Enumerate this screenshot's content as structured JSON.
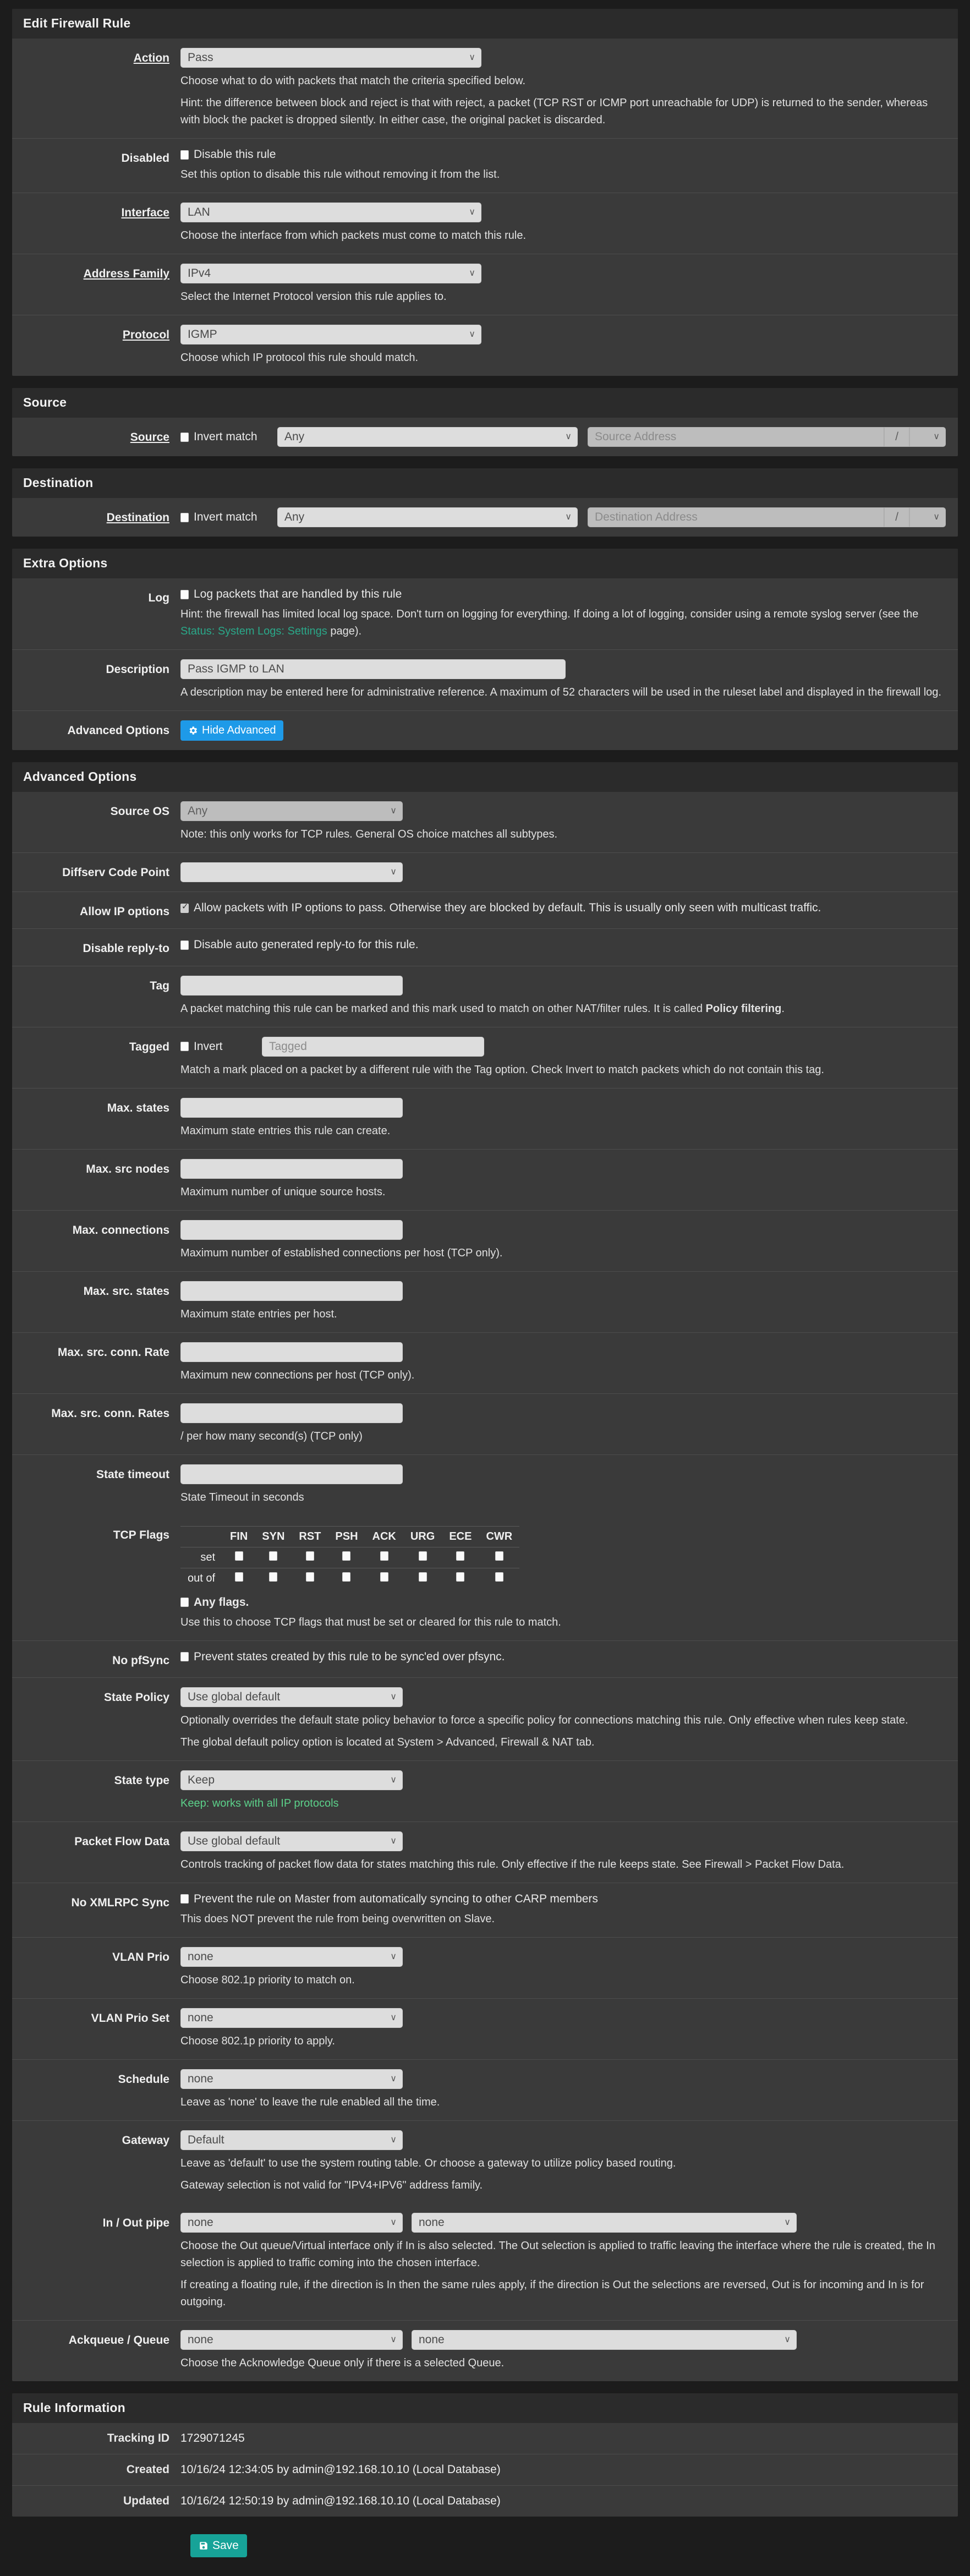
{
  "sections": {
    "rule": {
      "title": "Edit Firewall Rule",
      "action": {
        "label": "Action",
        "value": "Pass",
        "help1": "Choose what to do with packets that match the criteria specified below.",
        "help2": "Hint: the difference between block and reject is that with reject, a packet (TCP RST or ICMP port unreachable for UDP) is returned to the sender, whereas with block the packet is dropped silently. In either case, the original packet is discarded."
      },
      "disabled": {
        "label": "Disabled",
        "checkbox_label": "Disable this rule",
        "checked": false,
        "help": "Set this option to disable this rule without removing it from the list."
      },
      "interface": {
        "label": "Interface",
        "value": "LAN",
        "help": "Choose the interface from which packets must come to match this rule."
      },
      "address_family": {
        "label": "Address Family",
        "value": "IPv4",
        "help": "Select the Internet Protocol version this rule applies to."
      },
      "protocol": {
        "label": "Protocol",
        "value": "IGMP",
        "help": "Choose which IP protocol this rule should match."
      }
    },
    "source": {
      "title": "Source",
      "label": "Source",
      "invert_label": "Invert match",
      "invert_checked": false,
      "type": "Any",
      "address_placeholder": "Source Address",
      "slash": "/",
      "mask": ""
    },
    "destination": {
      "title": "Destination",
      "label": "Destination",
      "invert_label": "Invert match",
      "invert_checked": false,
      "type": "Any",
      "address_placeholder": "Destination Address",
      "slash": "/",
      "mask": ""
    },
    "extra": {
      "title": "Extra Options",
      "log": {
        "label": "Log",
        "checkbox_label": "Log packets that are handled by this rule",
        "checked": false,
        "help_pre": "Hint: the firewall has limited local log space. Don't turn on logging for everything. If doing a lot of logging, consider using a remote syslog server (see the ",
        "help_link": "Status: System Logs: Settings",
        "help_post": " page)."
      },
      "description": {
        "label": "Description",
        "value": "Pass IGMP to LAN",
        "help": "A description may be entered here for administrative reference. A maximum of 52 characters will be used in the ruleset label and displayed in the firewall log."
      },
      "advanced_options": {
        "label": "Advanced Options",
        "button_label": "Hide Advanced",
        "button_color": "#1e9ae8",
        "icon": "gear-icon"
      }
    },
    "advanced": {
      "title": "Advanced Options",
      "rows": [
        {
          "name": "source-os",
          "label": "Source OS",
          "kind": "select",
          "value": "Any",
          "dim": true,
          "width": "w-md",
          "help": "Note: this only works for TCP rules. General OS choice matches all subtypes."
        },
        {
          "name": "diffserv-code-point",
          "label": "Diffserv Code Point",
          "kind": "select",
          "value": "",
          "dim": false,
          "width": "w-md",
          "help": ""
        },
        {
          "name": "allow-ip-options",
          "label": "Allow IP options",
          "kind": "checkbox",
          "checkbox_label": "Allow packets with IP options to pass. Otherwise they are blocked by default. This is usually only seen with multicast traffic.",
          "checked": true,
          "help": ""
        },
        {
          "name": "disable-reply-to",
          "label": "Disable reply-to",
          "kind": "checkbox",
          "checkbox_label": "Disable auto generated reply-to for this rule.",
          "checked": false,
          "help": ""
        },
        {
          "name": "tag",
          "label": "Tag",
          "kind": "text",
          "value": "",
          "placeholder": "",
          "width": "w-md",
          "help_html": "A packet matching this rule can be marked and this mark used to match on other NAT/filter rules. It is called <b>Policy filtering</b>."
        },
        {
          "name": "tagged",
          "label": "Tagged",
          "kind": "invert-text",
          "invert_label": "Invert",
          "checked": false,
          "value": "",
          "placeholder": "Tagged",
          "help": "Match a mark placed on a packet by a different rule with the Tag option. Check Invert to match packets which do not contain this tag."
        },
        {
          "name": "max-states",
          "label": "Max. states",
          "kind": "text",
          "value": "",
          "placeholder": "",
          "width": "w-md",
          "help": "Maximum state entries this rule can create."
        },
        {
          "name": "max-src-nodes",
          "label": "Max. src nodes",
          "kind": "text",
          "value": "",
          "placeholder": "",
          "width": "w-md",
          "help": "Maximum number of unique source hosts."
        },
        {
          "name": "max-connections",
          "label": "Max. connections",
          "kind": "text",
          "value": "",
          "placeholder": "",
          "width": "w-md",
          "help": "Maximum number of established connections per host (TCP only)."
        },
        {
          "name": "max-src-states",
          "label": "Max. src. states",
          "kind": "text",
          "value": "",
          "placeholder": "",
          "width": "w-md",
          "help": "Maximum state entries per host."
        },
        {
          "name": "max-src-conn-rate",
          "label": "Max. src. conn. Rate",
          "kind": "text",
          "value": "",
          "placeholder": "",
          "width": "w-md",
          "help": "Maximum new connections per host (TCP only)."
        },
        {
          "name": "max-src-conn-rates",
          "label": "Max. src. conn. Rates",
          "kind": "text",
          "value": "",
          "placeholder": "",
          "width": "w-md",
          "help": "/ per how many second(s) (TCP only)"
        },
        {
          "name": "state-timeout",
          "label": "State timeout",
          "kind": "text",
          "value": "",
          "placeholder": "",
          "width": "w-md",
          "help": "State Timeout in seconds"
        }
      ],
      "tcp_flags": {
        "label": "TCP Flags",
        "columns": [
          "FIN",
          "SYN",
          "RST",
          "PSH",
          "ACK",
          "URG",
          "ECE",
          "CWR"
        ],
        "rows": [
          {
            "label": "set",
            "checked": [
              false,
              false,
              false,
              false,
              false,
              false,
              false,
              false
            ]
          },
          {
            "label": "out of",
            "checked": [
              false,
              false,
              false,
              false,
              false,
              false,
              false,
              false
            ]
          }
        ],
        "any_flags_label": "Any flags.",
        "any_flags_checked": false,
        "help": "Use this to choose TCP flags that must be set or cleared for this rule to match."
      },
      "tail_rows": [
        {
          "name": "no-pfsync",
          "label": "No pfSync",
          "kind": "checkbox",
          "checkbox_label": "Prevent states created by this rule to be sync'ed over pfsync.",
          "checked": false,
          "help": ""
        },
        {
          "name": "state-policy",
          "label": "State Policy",
          "kind": "select",
          "value": "Use global default",
          "width": "w-md",
          "help": "Optionally overrides the default state policy behavior to force a specific policy for connections matching this rule. Only effective when rules keep state.",
          "help2": "The global default policy option is located at System > Advanced, Firewall & NAT tab."
        },
        {
          "name": "state-type",
          "label": "State type",
          "kind": "select",
          "value": "Keep",
          "width": "w-md",
          "help_green": "Keep: works with all IP protocols"
        },
        {
          "name": "packet-flow-data",
          "label": "Packet Flow Data",
          "kind": "select",
          "value": "Use global default",
          "width": "w-md",
          "help": "Controls tracking of packet flow data for states matching this rule. Only effective if the rule keeps state. See Firewall > Packet Flow Data."
        },
        {
          "name": "no-xmlrpc-sync",
          "label": "No XMLRPC Sync",
          "kind": "checkbox",
          "checkbox_label": "Prevent the rule on Master from automatically syncing to other CARP members",
          "checked": false,
          "help": "This does NOT prevent the rule from being overwritten on Slave."
        },
        {
          "name": "vlan-prio",
          "label": "VLAN Prio",
          "kind": "select",
          "value": "none",
          "width": "w-md",
          "help": "Choose 802.1p priority to match on."
        },
        {
          "name": "vlan-prio-set",
          "label": "VLAN Prio Set",
          "kind": "select",
          "value": "none",
          "width": "w-md",
          "help": "Choose 802.1p priority to apply."
        },
        {
          "name": "schedule",
          "label": "Schedule",
          "kind": "select",
          "value": "none",
          "width": "w-md",
          "help": "Leave as 'none' to leave the rule enabled all the time."
        },
        {
          "name": "gateway",
          "label": "Gateway",
          "kind": "select",
          "value": "Default",
          "width": "w-md",
          "help": "Leave as 'default' to use the system routing table. Or choose a gateway to utilize policy based routing.",
          "help2": "Gateway selection is not valid for \"IPV4+IPV6\" address family."
        }
      ],
      "in_out_pipe": {
        "label": "In / Out pipe",
        "value_in": "none",
        "value_out": "none",
        "help": "Choose the Out queue/Virtual interface only if In is also selected. The Out selection is applied to traffic leaving the interface where the rule is created, the In selection is applied to traffic coming into the chosen interface.",
        "help2": "If creating a floating rule, if the direction is In then the same rules apply, if the direction is Out the selections are reversed, Out is for incoming and In is for outgoing."
      },
      "ackqueue": {
        "label": "Ackqueue / Queue",
        "value_ack": "none",
        "value_queue": "none",
        "help": "Choose the Acknowledge Queue only if there is a selected Queue."
      }
    },
    "rule_info": {
      "title": "Rule Information",
      "rows": [
        {
          "label": "Tracking ID",
          "value": "1729071245"
        },
        {
          "label": "Created",
          "value": "10/16/24 12:34:05 by admin@192.168.10.10 (Local Database)"
        },
        {
          "label": "Updated",
          "value": "10/16/24 12:50:19 by admin@192.168.10.10 (Local Database)"
        }
      ]
    },
    "footer": {
      "save_label": "Save",
      "save_color": "#17a398",
      "save_icon": "save-icon"
    }
  }
}
